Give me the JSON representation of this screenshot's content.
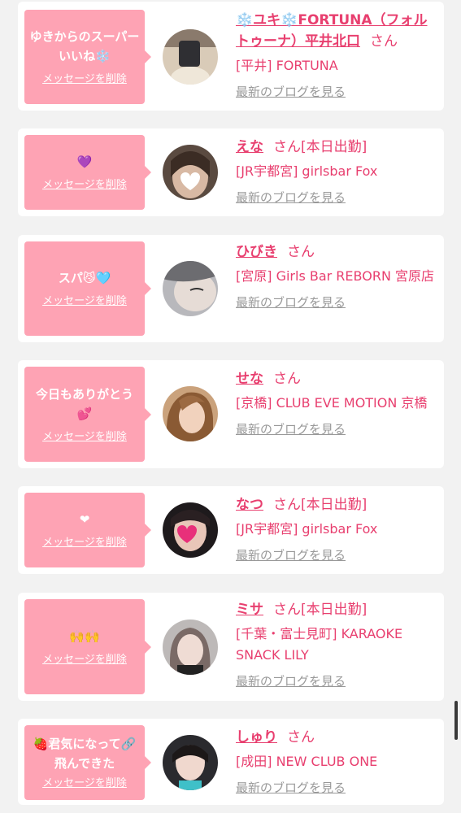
{
  "colors": {
    "page_bg": "#f2f2f2",
    "card_bg": "#ffffff",
    "bubble_bg": "#fea3b4",
    "accent_pink": "#e83f6f",
    "link_gray": "#999999"
  },
  "common": {
    "delete_label": "メッセージを削除",
    "blog_label": "最新のブログを見る",
    "honorific": "さん"
  },
  "items": [
    {
      "message": "ゆきからのスーパーいいね❄️",
      "name": "❄️ユキ❄️FORTUNA（フォルトゥーナ）平井北口",
      "shift": "",
      "store": "[平井] FORTUNA",
      "avatar_icon": "avatar-photo-icon"
    },
    {
      "message": "💜",
      "name": "えな",
      "shift": "[本日出勤]",
      "store": "[JR宇都宮] girlsbar Fox",
      "avatar_icon": "avatar-photo-icon"
    },
    {
      "message": "スパ😼🩵",
      "name": "ひびき",
      "shift": "",
      "store": "[宮原] Girls Bar REBORN 宮原店",
      "avatar_icon": "avatar-photo-icon"
    },
    {
      "message": "今日もありがとう💕",
      "name": "せな",
      "shift": "",
      "store": "[京橋] CLUB EVE MOTION 京橋",
      "avatar_icon": "avatar-photo-icon"
    },
    {
      "message": "❤︎",
      "name": "なつ",
      "shift": "[本日出勤]",
      "store": "[JR宇都宮] girlsbar Fox",
      "avatar_icon": "avatar-photo-icon"
    },
    {
      "message": "🙌🙌",
      "name": "ミサ",
      "shift": "[本日出勤]",
      "store": "[千葉・富士見町] KARAOKE SNACK LILY",
      "avatar_icon": "avatar-photo-icon"
    },
    {
      "message": "🍓君気になって🔗飛んできた",
      "name": "しゅり",
      "shift": "",
      "store": "[成田] NEW CLUB ONE",
      "avatar_icon": "avatar-photo-icon"
    }
  ]
}
